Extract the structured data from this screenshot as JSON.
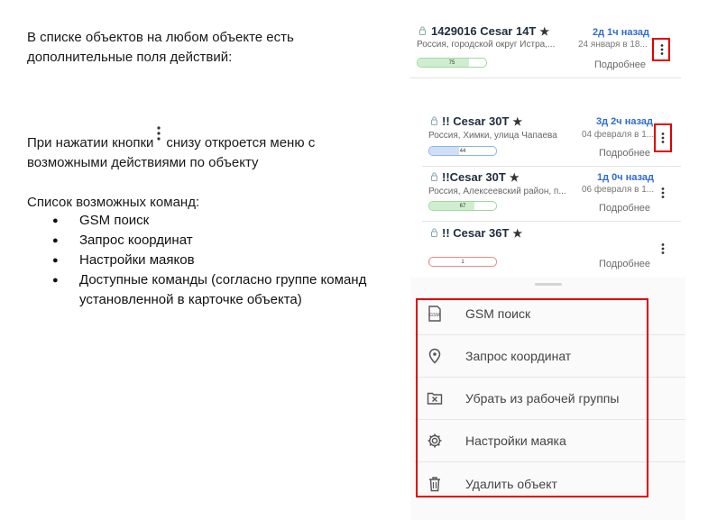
{
  "doc": {
    "para1": "В списке объектов на любом объекте есть дополнительные поля действий:",
    "para2_before": "При нажатии кнопки",
    "para2_after": "снизу откроется меню с возможными действиями по объекту",
    "list_title": "Список возможных команд:",
    "commands": [
      "GSM поиск",
      "Запрос координат",
      "Настройки маяков",
      "Доступные команды (согласно группе команд установленной в карточке объекта)"
    ]
  },
  "cards": [
    {
      "name": "1429016 Cesar 14T",
      "time": "2д 1ч назад",
      "address": "Россия, городской округ Истра,...",
      "date": "24 января в 18...",
      "more": "Подробнее",
      "battery_label": "75",
      "battery_fraction": 0.75,
      "battery_color": "#cfeecf",
      "battery_border": "#9fd99f"
    },
    {
      "name": "!! Cesar 30T",
      "time": "3д 2ч назад",
      "address": "Россия, Химки, улица Чапаева",
      "date": "04 февраля в 1...",
      "more": "Подробнее",
      "battery_label": "44",
      "battery_fraction": 0.44,
      "battery_color": "#cfe0f6",
      "battery_border": "#8fb4e4"
    },
    {
      "name": "!!Cesar 30T",
      "time": "1д 0ч назад",
      "address": "Россия, Алексеевский район, п...",
      "date": "06 февраля в 1...",
      "more": "Подробнее",
      "battery_label": "67",
      "battery_fraction": 0.67,
      "battery_color": "#cfeecf",
      "battery_border": "#9fd99f"
    },
    {
      "name": "!! Cesar 36T",
      "time": "",
      "address": "",
      "date": "",
      "more": "Подробнее",
      "battery_label": "1",
      "battery_fraction": 0.01,
      "battery_color": "#fbdada",
      "battery_border": "#e88a8a"
    }
  ],
  "menu": {
    "items": [
      {
        "label": "GSM поиск",
        "icon": "gsm-icon"
      },
      {
        "label": "Запрос координат",
        "icon": "location-pin-icon"
      },
      {
        "label": "Убрать из рабочей группы",
        "icon": "remove-from-group-icon"
      },
      {
        "label": "Настройки маяка",
        "icon": "gear-icon"
      },
      {
        "label": "Удалить объект",
        "icon": "trash-icon"
      }
    ]
  },
  "colors": {
    "highlight": "#e00000",
    "time_accent": "#2f6bd6"
  }
}
